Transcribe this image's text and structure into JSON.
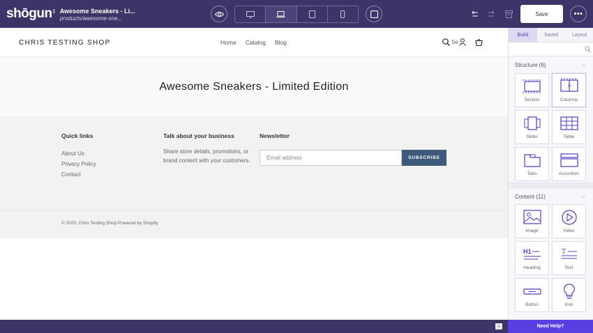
{
  "topbar": {
    "logo": "shōgun",
    "page_title": "Awesome Sneakers - Li...",
    "page_path": "products/awesome-sne...",
    "save_label": "Save",
    "icons": [
      "eye-icon",
      "desktop-icon",
      "laptop-icon",
      "tablet-icon",
      "mobile-icon",
      "frame-icon",
      "undo-icon",
      "redo-icon",
      "archive-icon",
      "more-icon"
    ]
  },
  "shop": {
    "name": "CHRIS TESTING SHOP",
    "nav": [
      "Home",
      "Catalog",
      "Blog"
    ],
    "search_text": "Se",
    "product_title": "Awesome Sneakers - Limited Edition"
  },
  "footer": {
    "quick_links_title": "Quick links",
    "links": [
      "About Us",
      "Privacy Policy",
      "Contact"
    ],
    "business_title": "Talk about your business",
    "business_text": "Share store details, promotions, or brand content with your customers.",
    "newsletter_title": "Newsletter",
    "email_placeholder": "Email address",
    "subscribe_label": "SUBSCRIBE",
    "copyright": "© 2020, Chris Testing Shop Powered by Shopify"
  },
  "panel": {
    "tabs": [
      "Build",
      "Saved",
      "Layout"
    ],
    "active_tab": "Build",
    "structure_header": "Structure (6)",
    "structure_items": [
      "Section",
      "Columns",
      "Slider",
      "Table",
      "Tabs",
      "Accordion"
    ],
    "content_header": "Content (11)",
    "content_items": [
      "Image",
      "Video",
      "Heading",
      "Text",
      "Button",
      "Icon"
    ],
    "accent": "#5a3fe0"
  },
  "bottombar": {
    "collapse_label": "»",
    "help_label": "Need Help?"
  }
}
